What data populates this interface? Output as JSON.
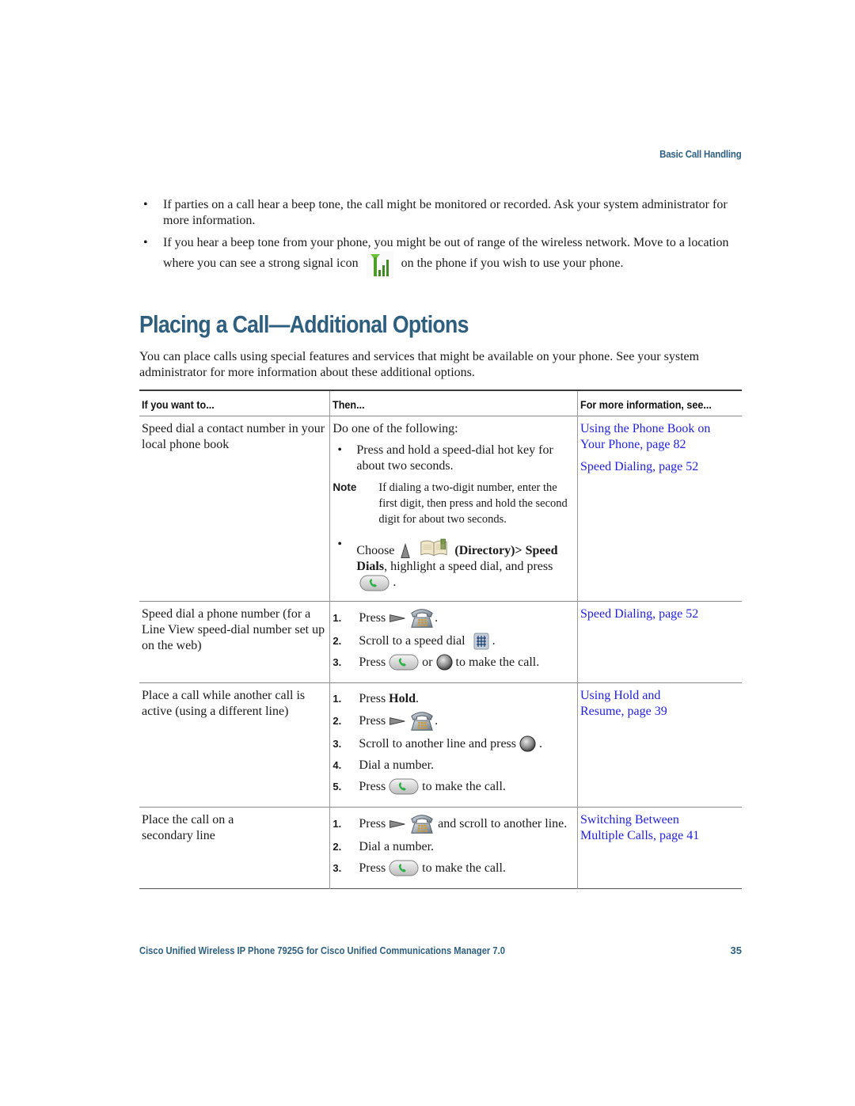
{
  "header": {
    "section": "Basic Call Handling"
  },
  "bullets": [
    {
      "text": "If parties on a call hear a beep tone, the call might be monitored or recorded. Ask your system administrator for more information."
    },
    {
      "text_before": "If you hear a beep tone from your phone, you might be out of range of the wireless network. Move to a location where you can see a strong signal icon",
      "icon": "signal-strength-icon",
      "text_after": "on the phone if you wish to use your phone."
    }
  ],
  "section": {
    "title": "Placing a Call—Additional Options",
    "intro": "You can place calls using special features and services that might be available on your phone. See your system administrator for more information about these additional options."
  },
  "table": {
    "headers": [
      "If you want to...",
      "Then...",
      "For more information, see..."
    ],
    "rows": [
      {
        "want": "Speed dial a contact number in your local phone book",
        "then": {
          "lead": "Do one of the following:",
          "option1": "Press and hold a speed-dial hot key for about two seconds.",
          "note_label": "Note",
          "note_text": "If dialing a two-digit number, enter the first digit, then press and hold the second digit for about two seconds.",
          "option2_choose": "Choose",
          "option2_menu": "(Directory)> Speed Dials",
          "option2_rest": ", highlight a speed dial, and press",
          "option2_end": "."
        },
        "links": [
          "Using the Phone Book on Your Phone, page 82",
          "Speed Dialing, page 52"
        ]
      },
      {
        "want": "Speed dial a phone number (for a Line View speed-dial number set up on the web)",
        "steps": [
          {
            "num": "1.",
            "a": "Press",
            "b": "."
          },
          {
            "num": "2.",
            "a": "Scroll to a speed dial",
            "b": "."
          },
          {
            "num": "3.",
            "a": "Press",
            "mid": "or",
            "b": "to make the call."
          }
        ],
        "links": [
          "Speed Dialing, page 52"
        ]
      },
      {
        "want": "Place a call while another call is active (using a different line)",
        "steps": [
          {
            "num": "1.",
            "a": "Press",
            "bold": "Hold",
            "b": "."
          },
          {
            "num": "2.",
            "a": "Press",
            "b": "."
          },
          {
            "num": "3.",
            "a": "Scroll to another line and press",
            "b": "."
          },
          {
            "num": "4.",
            "a": "Dial a number."
          },
          {
            "num": "5.",
            "a": "Press",
            "b": "to make the call."
          }
        ],
        "links": [
          "Using Hold and Resume, page 39"
        ]
      },
      {
        "want": "Place the call on a secondary line",
        "steps": [
          {
            "num": "1.",
            "a": "Press",
            "b": "and scroll to another line."
          },
          {
            "num": "2.",
            "a": "Dial a number."
          },
          {
            "num": "3.",
            "a": "Press",
            "b": "to make the call."
          }
        ],
        "links": [
          "Switching Between Multiple Calls, page 41"
        ]
      }
    ]
  },
  "footer": {
    "title": "Cisco Unified Wireless IP Phone 7925G for Cisco Unified Communications Manager 7.0",
    "page": "35"
  },
  "colors": {
    "heading": "#2e5f7f",
    "link": "#1f1fe0"
  }
}
